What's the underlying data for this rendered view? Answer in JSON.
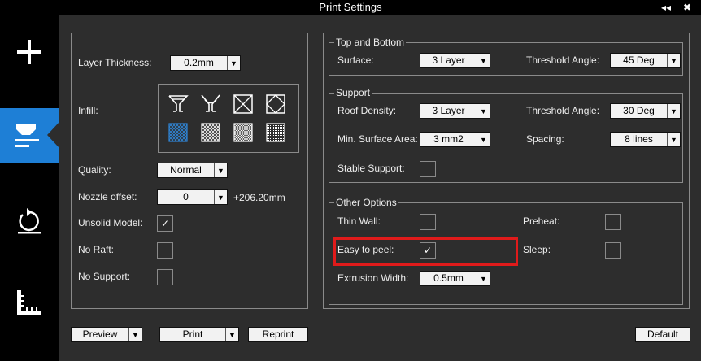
{
  "window": {
    "title": "Print Settings",
    "collapse_glyph": "◂◂",
    "close_glyph": "✖"
  },
  "sidebar": {
    "items": [
      {
        "name": "add",
        "icon": "plus-icon"
      },
      {
        "name": "print-settings",
        "icon": "print-settings-icon",
        "active": true
      },
      {
        "name": "rotate",
        "icon": "rotate-icon"
      },
      {
        "name": "measure",
        "icon": "ruler-icon"
      }
    ]
  },
  "left": {
    "layer_thickness": {
      "label": "Layer Thickness:",
      "value": "0.2mm"
    },
    "infill": {
      "label": "Infill:",
      "selected_index": 4,
      "patterns": [
        "hollow-goblet",
        "open-goblet",
        "x-cross",
        "diamond",
        "dense-crosshatch",
        "crosshatch",
        "fine-crosshatch",
        "solid"
      ]
    },
    "quality": {
      "label": "Quality:",
      "value": "Normal"
    },
    "nozzle_offset": {
      "label": "Nozzle offset:",
      "value": "0",
      "readout": "+206.20mm"
    },
    "unsolid_model": {
      "label": "Unsolid Model:",
      "checked": true
    },
    "no_raft": {
      "label": "No Raft:",
      "checked": false
    },
    "no_support": {
      "label": "No Support:",
      "checked": false
    }
  },
  "top_bottom": {
    "legend": "Top and Bottom",
    "surface": {
      "label": "Surface:",
      "value": "3 Layer"
    },
    "threshold_angle": {
      "label": "Threshold Angle:",
      "value": "45 Deg"
    }
  },
  "support": {
    "legend": "Support",
    "roof_density": {
      "label": "Roof Density:",
      "value": "3 Layer"
    },
    "threshold_angle": {
      "label": "Threshold Angle:",
      "value": "30 Deg"
    },
    "min_surface_area": {
      "label": "Min. Surface Area:",
      "value": "3 mm2"
    },
    "spacing": {
      "label": "Spacing:",
      "value": "8 lines"
    },
    "stable_support": {
      "label": "Stable Support:",
      "checked": false
    }
  },
  "other": {
    "legend": "Other Options",
    "thin_wall": {
      "label": "Thin Wall:",
      "checked": false
    },
    "preheat": {
      "label": "Preheat:",
      "checked": false
    },
    "easy_to_peel": {
      "label": "Easy to peel:",
      "checked": true
    },
    "sleep": {
      "label": "Sleep:",
      "checked": false
    },
    "extrusion_width": {
      "label": "Extrusion Width:",
      "value": "0.5mm"
    }
  },
  "footer": {
    "preview": "Preview",
    "print": "Print",
    "reprint": "Reprint",
    "default": "Default"
  },
  "glyphs": {
    "arrow": "▼",
    "check": "✓"
  },
  "colors": {
    "accent": "#1e7fd6",
    "highlight": "#e01b1b",
    "panel_bg": "#2d2d2d"
  }
}
